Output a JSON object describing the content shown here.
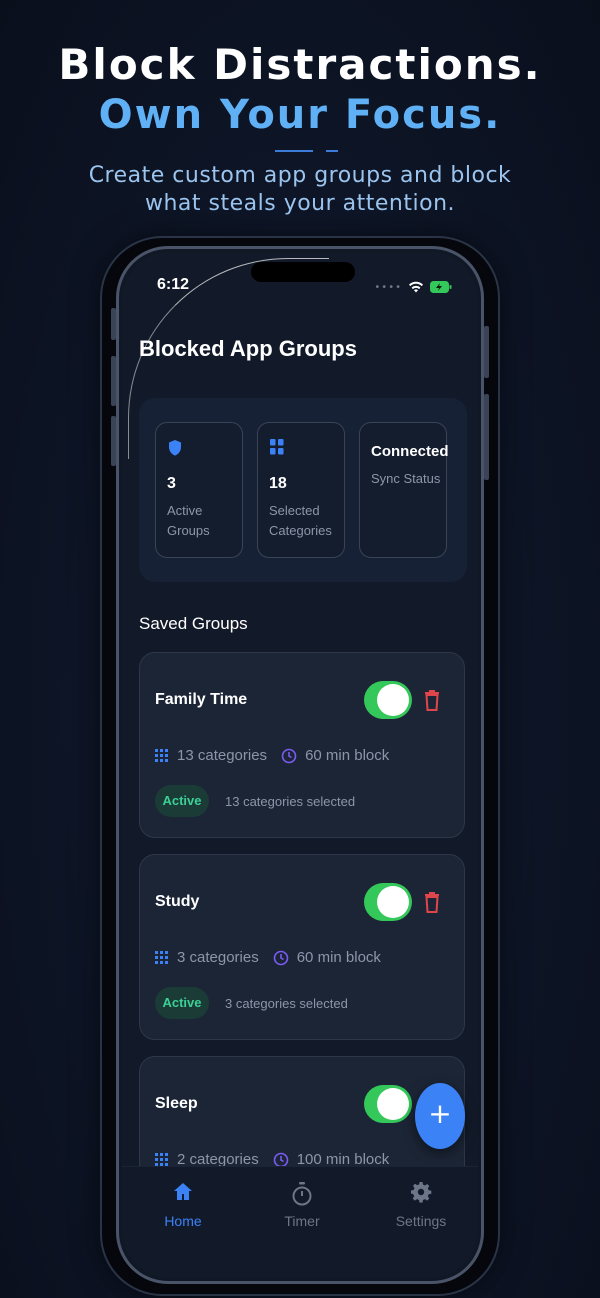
{
  "hero": {
    "title_line1": "Block Distractions.",
    "title_line2": "Own Your Focus.",
    "subtitle_line1": "Create custom app groups and block",
    "subtitle_line2": "what steals your attention."
  },
  "status_bar": {
    "time": "6:12"
  },
  "page_title": "Blocked App Groups",
  "stats": {
    "active": {
      "value": "3",
      "label": "Active Groups"
    },
    "selected": {
      "value": "18",
      "label": "Selected Categories"
    },
    "sync": {
      "title": "Connected",
      "label": "Sync Status"
    }
  },
  "section_title": "Saved Groups",
  "groups": [
    {
      "name": "Family Time",
      "categories": "13 categories",
      "block": "60 min block",
      "badge": "Active",
      "note": "13 categories selected",
      "enabled": true
    },
    {
      "name": "Study",
      "categories": "3 categories",
      "block": "60 min block",
      "badge": "Active",
      "note": "3 categories selected",
      "enabled": true
    },
    {
      "name": "Sleep",
      "categories": "2 categories",
      "block": "100 min block",
      "badge": "",
      "note": "",
      "enabled": true
    }
  ],
  "fab_label": "+",
  "tabs": [
    {
      "label": "Home",
      "active": true
    },
    {
      "label": "Timer",
      "active": false
    },
    {
      "label": "Settings",
      "active": false
    }
  ],
  "colors": {
    "accent_blue": "#3b82f6",
    "toggle_green": "#34c759",
    "badge_green": "#3ccf96",
    "trash_red": "#e0454b",
    "clock_purple": "#7a5cf0"
  }
}
